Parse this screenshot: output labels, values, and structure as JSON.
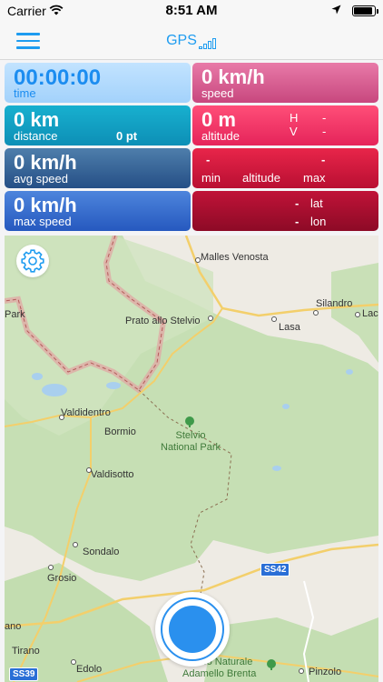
{
  "status_bar": {
    "carrier": "Carrier",
    "time": "8:51 AM",
    "icons": [
      "wifi-icon",
      "location-arrow-icon",
      "battery-icon"
    ],
    "battery_level": 0.9
  },
  "nav": {
    "title": "GPS",
    "menu_icon": "hamburger-icon",
    "signal_icon": "signal-strength-icon"
  },
  "tiles": {
    "time": {
      "value": "00:00:00",
      "label": "time"
    },
    "speed": {
      "value": "0 km/h",
      "label": "speed"
    },
    "distance": {
      "value": "0 km",
      "label": "distance",
      "points": "0 pt"
    },
    "altitude": {
      "value": "0 m",
      "label": "altitude",
      "h_label": "H",
      "h_value": "-",
      "v_label": "V",
      "v_value": "-"
    },
    "altitude_range": {
      "min_value": "-",
      "max_value": "-",
      "min_label": "min",
      "mid_label": "altitude",
      "max_label": "max"
    },
    "avg_speed": {
      "value": "0 km/h",
      "label": "avg speed"
    },
    "max_speed": {
      "value": "0 km/h",
      "label": "max speed"
    },
    "position": {
      "lat_value": "-",
      "lat_label": "lat",
      "lon_value": "-",
      "lon_label": "lon"
    }
  },
  "colors": {
    "accent": "#1e9cf0",
    "time_tile": "#a3d2fb",
    "speed_tile": "#c8477e",
    "distance_tile": "#0d8fb6",
    "altitude_tile": "#e5245a",
    "avg_speed_tile": "#254f86",
    "altitude_range_tile": "#b90f32",
    "max_speed_tile": "#2659bf",
    "position_tile": "#8d0a26"
  },
  "map": {
    "places": [
      "Malles Venosta",
      "Silandro",
      "Lac",
      "Prato allo Stelvio",
      "Lasa",
      "Park",
      "Valdidentro",
      "Bormio",
      "Valdisotto",
      "Sondalo",
      "Grosio",
      "ano",
      "Tirano",
      "Edolo",
      "Pinzolo"
    ],
    "park_1": "Stelvio\nNational Park",
    "park_2": "Parco Naturale\nAdamello Brenta",
    "road_1": "SS42",
    "road_2": "SS39"
  },
  "controls": {
    "settings_icon": "gear-icon",
    "record_icon": "record-icon"
  }
}
